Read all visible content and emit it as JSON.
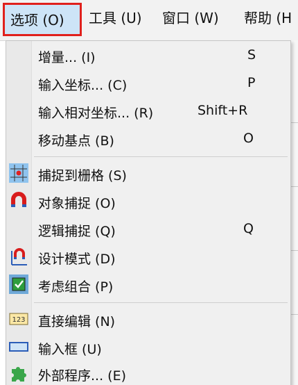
{
  "menubar": {
    "options": "选项 (O)",
    "tools": "工具 (U)",
    "window": "窗口 (W)",
    "help": "帮助 (H"
  },
  "menu": {
    "items": [
      {
        "label": "增量... (I)",
        "shortcut": "S",
        "icon": ""
      },
      {
        "label": "输入坐标... (C)",
        "shortcut": "P",
        "icon": ""
      },
      {
        "label": "输入相对坐标... (R)",
        "shortcut": "Shift+R",
        "icon": ""
      },
      {
        "label": "移动基点 (B)",
        "shortcut": "O",
        "icon": ""
      },
      {
        "label": "捕捉到栅格 (S)",
        "shortcut": "",
        "icon": "grid-snap-icon"
      },
      {
        "label": "对象捕捉 (O)",
        "shortcut": "",
        "icon": "magnet-icon"
      },
      {
        "label": "逻辑捕捉 (Q)",
        "shortcut": "Q",
        "icon": ""
      },
      {
        "label": "设计模式 (D)",
        "shortcut": "",
        "icon": "design-mode-icon"
      },
      {
        "label": "考虑组合 (P)",
        "shortcut": "",
        "icon": "group-icon"
      },
      {
        "label": "直接编辑 (N)",
        "shortcut": "",
        "icon": "direct-edit-icon"
      },
      {
        "label": "输入框 (U)",
        "shortcut": "",
        "icon": "input-box-icon"
      },
      {
        "label": "外部程序... (E)",
        "shortcut": "",
        "icon": "puzzle-icon"
      }
    ]
  },
  "colors": {
    "highlight_border": "#e0201c",
    "highlight_fill": "#cde4f7",
    "menu_bg": "#f0f0f0"
  }
}
